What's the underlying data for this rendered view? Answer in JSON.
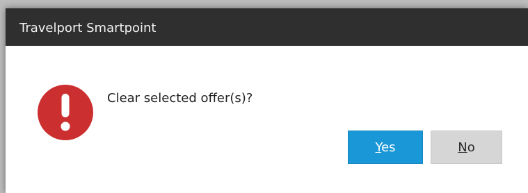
{
  "window": {
    "title": "Travelport Smartpoint"
  },
  "dialog": {
    "icon": "error-exclamation-icon",
    "message": "Clear selected offer(s)?"
  },
  "buttons": {
    "yes": {
      "mnemonic": "Y",
      "rest": "es"
    },
    "no": {
      "mnemonic": "N",
      "rest": "o"
    }
  },
  "colors": {
    "titlebar": "#2f2f2f",
    "icon_red": "#cc2f2f",
    "primary_button": "#1a97d6",
    "secondary_button": "#d6d6d6"
  }
}
